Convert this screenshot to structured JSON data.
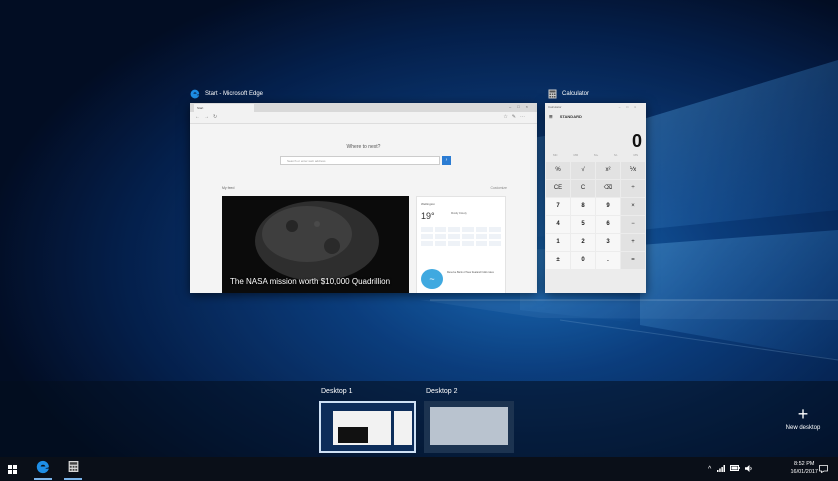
{
  "windows": [
    {
      "id": "edge",
      "title": "Start - Microsoft Edge",
      "icon": "edge-icon",
      "tab_label": "Start",
      "prompt": "Where to next?",
      "search_placeholder": "Search or enter web address",
      "feed_label": "My feed",
      "customize_label": "Customize",
      "hero_caption": "The NASA mission worth $10,000 Quadrillion",
      "weather": {
        "city": "Wellington",
        "temp": "19°",
        "desc": "Mostly Cloudy"
      },
      "news_text": "Reserve Bank of New Zealand holds rates"
    },
    {
      "id": "calculator",
      "title": "Calculator",
      "icon": "calculator-icon",
      "app_title": "Calculator",
      "mode": "STANDARD",
      "display": "0",
      "memory_keys": [
        "MC",
        "MR",
        "M+",
        "M-",
        "MS"
      ],
      "keys": [
        "%",
        "√",
        "x²",
        "⅟x",
        "CE",
        "C",
        "⌫",
        "÷",
        "7",
        "8",
        "9",
        "×",
        "4",
        "5",
        "6",
        "−",
        "1",
        "2",
        "3",
        "+",
        "±",
        "0",
        ".",
        "="
      ]
    }
  ],
  "desktops": [
    {
      "label": "Desktop 1",
      "active": true
    },
    {
      "label": "Desktop 2",
      "active": false
    }
  ],
  "new_desktop_label": "New desktop",
  "taskbar": {
    "items": [
      "start-icon",
      "edge-icon",
      "calculator-icon"
    ],
    "tray_icons": [
      "chevron-up-icon",
      "network-icon",
      "battery-icon",
      "volume-icon"
    ],
    "time": "8:52 PM",
    "date": "16/01/2017"
  },
  "colors": {
    "accent": "#2b7cd3",
    "taskbar": "#0a0f18",
    "edge_blue": "#1e8ee6"
  }
}
